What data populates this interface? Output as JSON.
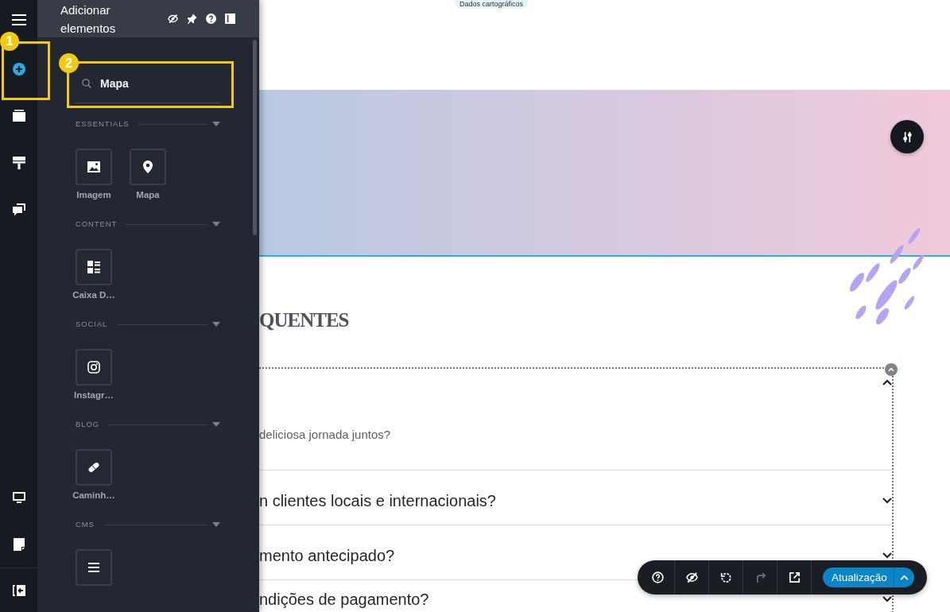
{
  "rail": {
    "top": [
      {
        "selected": false
      },
      {
        "selected": true
      },
      {
        "selected": false
      },
      {
        "selected": false
      },
      {
        "selected": false
      }
    ],
    "bottom": [
      {
        "selected": false
      },
      {
        "selected": false
      },
      {
        "selected": false
      }
    ]
  },
  "callouts": [
    {
      "number": "1"
    },
    {
      "number": "2"
    }
  ],
  "panel": {
    "title": "Adicionar elementos",
    "search": {
      "value": "Mapa"
    },
    "sections": [
      {
        "title": "ESSENTIALS",
        "expanded": true,
        "items": [
          {
            "label": "Imagem"
          },
          {
            "label": "Mapa"
          }
        ]
      },
      {
        "title": "CONTENT",
        "expanded": true,
        "items": [
          {
            "label": "Caixa D…"
          }
        ]
      },
      {
        "title": "SOCIAL",
        "expanded": true,
        "items": [
          {
            "label": "Instagr…"
          }
        ]
      },
      {
        "title": "BLOG",
        "expanded": true,
        "items": [
          {
            "label": "Caminh…"
          }
        ]
      },
      {
        "title": "CMS",
        "expanded": true
      }
    ]
  },
  "canvas": {
    "map_attribution": "Dados cartográficos",
    "heading": "QUENTES",
    "faq": {
      "items": [
        {
          "expanded": true,
          "answer": "deliciosa jornada juntos?"
        },
        {
          "expanded": false,
          "question": "n clientes locais e internacionais?"
        },
        {
          "expanded": false,
          "question": "mento antecipado?"
        },
        {
          "expanded": false,
          "question": "ndições de pagamento?"
        }
      ]
    }
  },
  "toolbar": {
    "buttons": [
      {
        "disabled": false
      },
      {
        "disabled": false
      },
      {
        "disabled": false
      },
      {
        "disabled": true
      },
      {
        "disabled": false
      }
    ],
    "publish": {
      "label": "Atualização"
    }
  }
}
